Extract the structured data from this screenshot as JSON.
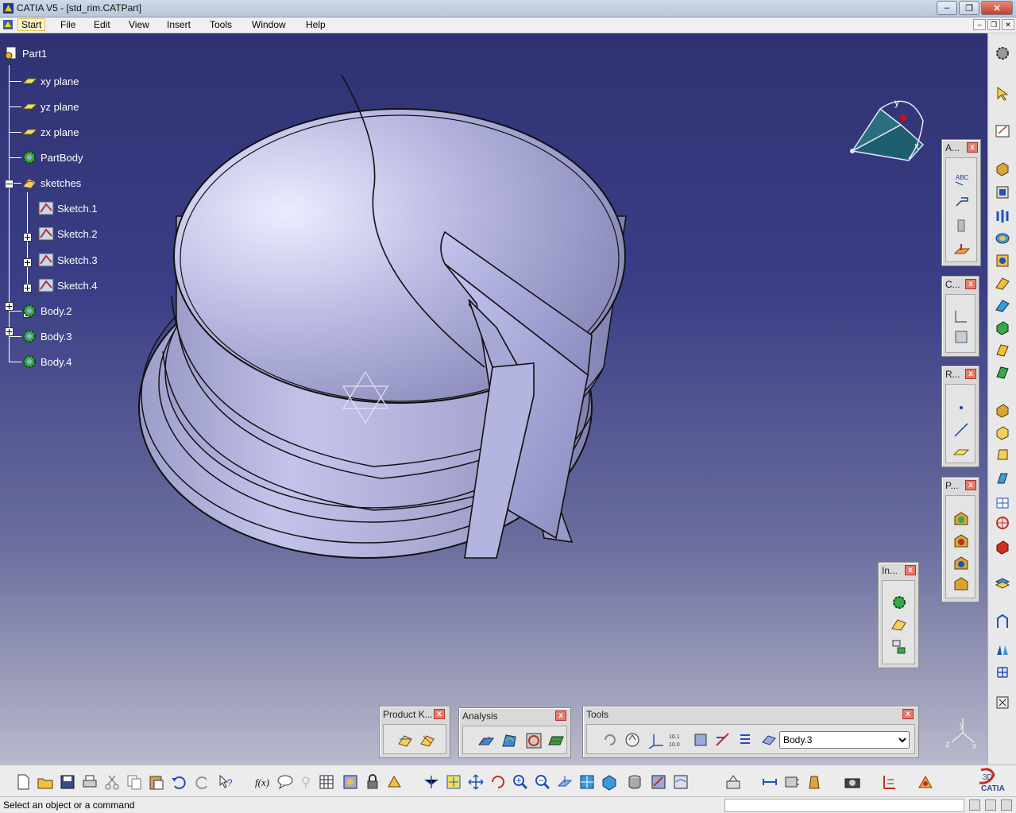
{
  "window": {
    "title": "CATIA V5 - [std_rim.CATPart]",
    "minimize": "–",
    "restore": "❐",
    "close": "✕"
  },
  "menu": [
    "Start",
    "File",
    "Edit",
    "View",
    "Insert",
    "Tools",
    "Window",
    "Help"
  ],
  "tree": {
    "root": "Part1",
    "items": [
      "xy plane",
      "yz plane",
      "zx plane",
      "PartBody",
      "sketches",
      "Sketch.1",
      "Sketch.2",
      "Sketch.3",
      "Sketch.4",
      "Body.2",
      "Body.3",
      "Body.4"
    ]
  },
  "compass_axes": {
    "x": "x",
    "y": "y"
  },
  "mini_axes": {
    "x": "x",
    "y": "y",
    "z": "z"
  },
  "toolbars": {
    "annotations": "A...",
    "constraints": "C...",
    "reference": "R...",
    "part_design": "P...",
    "insert": "In...",
    "product_knowledge": "Product K...",
    "analysis": "Analysis",
    "tools": "Tools",
    "close": "x"
  },
  "tools_body_select": {
    "selected": "Body.3",
    "options": [
      "Body.3"
    ]
  },
  "status": {
    "text": "Select an object or a command"
  },
  "brand": "CATIA",
  "colors": {
    "viewport_top": "#2f3273",
    "viewport_bottom": "#b9b9cc",
    "part_fill": "#b9b9e3",
    "tree_text": "#ffffff"
  }
}
